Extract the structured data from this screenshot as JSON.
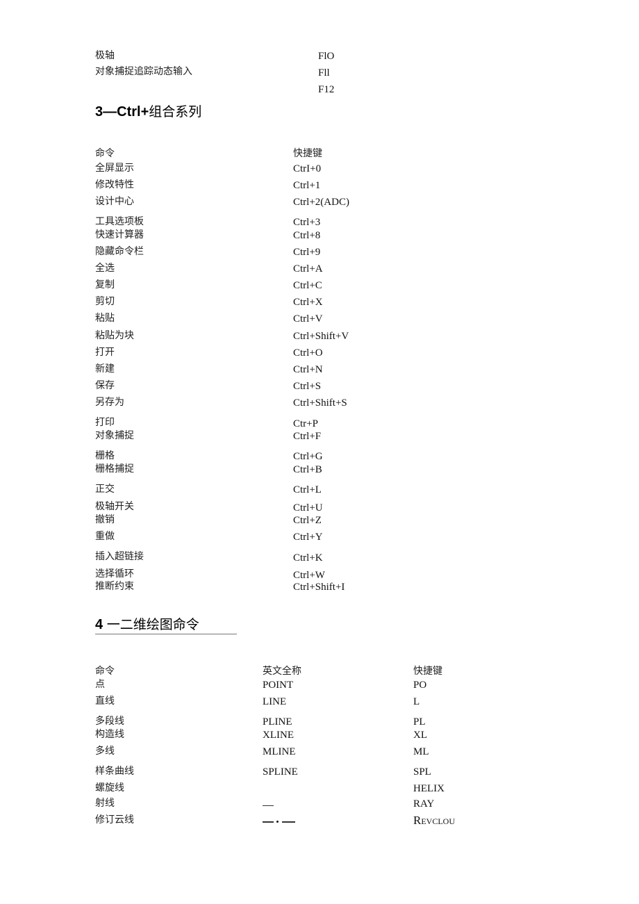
{
  "section2_tail": {
    "rows": [
      {
        "name": "极轴",
        "key": "FlO"
      },
      {
        "name": "对象捕捉追踪动态输入",
        "key": "Fll"
      },
      {
        "name": "",
        "key": "F12"
      }
    ]
  },
  "section3": {
    "heading_num": "3—Ctrl+",
    "heading_text": "组合系列",
    "col_command": "命令",
    "col_shortcut": "快捷键",
    "rows": [
      {
        "name": "全屏显示",
        "key": "CtrI+0"
      },
      {
        "name": "修改特性",
        "key": "Ctrl+1"
      },
      {
        "name": "设计中心",
        "key": "Ctrl+2(ADC)"
      },
      {
        "name": "工具选项板",
        "key": "Ctrl+3"
      },
      {
        "name": "快速计算器",
        "key": "Ctrl+8"
      },
      {
        "name": "隐藏命令栏",
        "key": "Ctrl+9"
      },
      {
        "name": "全选",
        "key": "Ctrl+A"
      },
      {
        "name": "复制",
        "key": "Ctrl+C"
      },
      {
        "name": "剪切",
        "key": "Ctrl+X"
      },
      {
        "name": "粘贴",
        "key": "Ctrl+V"
      },
      {
        "name": "粘贴为块",
        "key": "Ctrl+Shift+V"
      },
      {
        "name": "打开",
        "key": "Ctrl+O"
      },
      {
        "name": "新建",
        "key": "Ctrl+N"
      },
      {
        "name": "保存",
        "key": "Ctrl+S"
      },
      {
        "name": "另存为",
        "key": "Ctrl+Shift+S"
      },
      {
        "name": "打印",
        "key": "Ctr+P"
      },
      {
        "name": "对象捕捉",
        "key": "Ctrl+F"
      },
      {
        "name": "栅格",
        "key": "Ctrl+G"
      },
      {
        "name": "栅格捕捉",
        "key": "Ctrl+B"
      },
      {
        "name": "正交",
        "key": "Ctrl+L"
      },
      {
        "name": "极轴开关",
        "key": "Ctrl+U"
      },
      {
        "name": "撤销",
        "key": "Ctrl+Z"
      },
      {
        "name": "重做",
        "key": "Ctrl+Y"
      },
      {
        "name": "插入超链接",
        "key": "Ctrl+K"
      },
      {
        "name": "选择循环",
        "key": "Ctrl+W"
      },
      {
        "name": "推断约束",
        "key": "Ctrl+Shift+I"
      }
    ]
  },
  "section4": {
    "heading_num": "4",
    "heading_text": "一二维绘图命令",
    "col_command": "命令",
    "col_english": "英文全称",
    "col_shortcut": "快捷键",
    "rows": [
      {
        "name": "点",
        "english": "POINT",
        "key": "PO"
      },
      {
        "name": "直线",
        "english": "LINE",
        "key": "L"
      },
      {
        "name": "多段线",
        "english": "PLINE",
        "key": "PL"
      },
      {
        "name": "构造线",
        "english": "XLINE",
        "key": "XL"
      },
      {
        "name": "多线",
        "english": "MLINE",
        "key": "ML"
      },
      {
        "name": "样条曲线",
        "english": "SPLINE",
        "key": "SPL"
      },
      {
        "name": "螺旋线",
        "english": "",
        "key": "HELIX"
      },
      {
        "name": "射线",
        "english": "—",
        "key": "RAY"
      },
      {
        "name": "修订云线",
        "english": "—·—",
        "key": "REVCLOU"
      }
    ]
  }
}
